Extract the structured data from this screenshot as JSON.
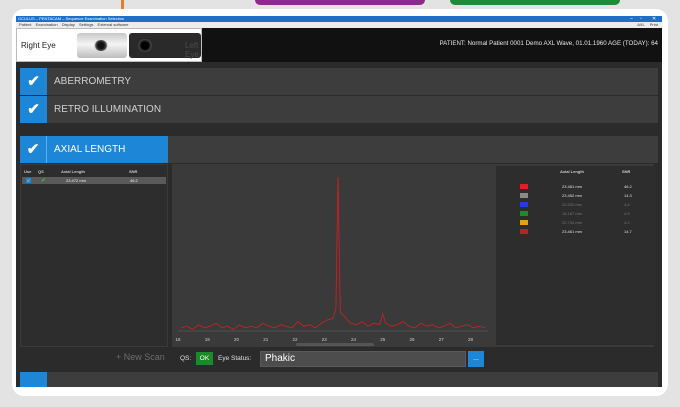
{
  "window": {
    "title": "OCULUS – PENTACAM – Sequence Examination Selection",
    "controls": [
      "–",
      "▫",
      "✕"
    ]
  },
  "menu": {
    "items": [
      "Patient",
      "Examination",
      "Display",
      "Settings",
      "External software"
    ],
    "right_items": [
      "AXL",
      "Print"
    ]
  },
  "header": {
    "right_eye_label": "Right Eye",
    "left_eye_label": "Left Eye",
    "patient_info": "PATIENT: Normal Patient 0001 Demo AXL Wave, 01.01.1960   AGE (TODAY): 64"
  },
  "sections": [
    {
      "label": "ABERROMETRY",
      "checked": true
    },
    {
      "label": "RETRO ILLUMINATION",
      "checked": true
    },
    {
      "label": "AXIAL LENGTH",
      "checked": true,
      "active": true
    }
  ],
  "scan_table": {
    "headers": [
      "Use",
      "QS",
      "Axial Length",
      "SNR"
    ],
    "rows": [
      {
        "axial_length": "23.472 mm",
        "snr": "46.2"
      }
    ]
  },
  "legend": {
    "headers": [
      "Axial Length",
      "SNR"
    ],
    "rows": [
      {
        "color": "#e02020",
        "axial_length": "23.481 mm",
        "snr": "46.2"
      },
      {
        "color": "#8a8a8a",
        "axial_length": "23.452 mm",
        "snr": "14.3"
      },
      {
        "color": "#1f3fd8",
        "axial_length": "20.330 mm",
        "snr": "4.6"
      },
      {
        "color": "#1f8a2a",
        "axial_length": "18.187 mm",
        "snr": "4.9"
      },
      {
        "color": "#e0a020",
        "axial_length": "22.734 mm",
        "snr": "4.2"
      },
      {
        "color": "#c02020",
        "axial_length": "23.461 mm",
        "snr": "14.7"
      }
    ]
  },
  "chart_data": {
    "type": "line",
    "x_ticks": [
      "18",
      "19",
      "20",
      "21",
      "22",
      "23",
      "24",
      "25",
      "26",
      "27",
      "28"
    ],
    "xlim": [
      18,
      28.6
    ],
    "ylim": [
      0,
      100
    ],
    "series": [
      {
        "color": "#d42020",
        "x": [
          18.1,
          18.3,
          18.5,
          18.7,
          18.9,
          19.1,
          19.3,
          19.5,
          19.7,
          19.9,
          20.1,
          20.3,
          20.5,
          20.7,
          20.9,
          21.1,
          21.3,
          21.5,
          21.7,
          21.9,
          22.1,
          22.3,
          22.5,
          22.7,
          22.9,
          23.1,
          23.3,
          23.4,
          23.47,
          23.55,
          23.7,
          23.9,
          24.1,
          24.3,
          24.5,
          24.7,
          24.9,
          25.0,
          25.1,
          25.3,
          25.5,
          25.7,
          25.9,
          26.1,
          26.3,
          26.5,
          26.7,
          26.9,
          27.1,
          27.3,
          27.5,
          27.7,
          27.9,
          28.1,
          28.3,
          28.5
        ],
        "y": [
          2,
          3,
          1,
          4,
          2,
          3,
          5,
          2,
          3,
          1,
          4,
          2,
          3,
          2,
          5,
          3,
          2,
          4,
          3,
          2,
          6,
          3,
          4,
          2,
          5,
          7,
          8,
          14,
          98,
          12,
          9,
          5,
          4,
          6,
          3,
          5,
          4,
          11,
          5,
          3,
          4,
          6,
          3,
          2,
          5,
          3,
          4,
          2,
          3,
          5,
          2,
          3,
          4,
          2,
          3,
          2
        ]
      }
    ]
  },
  "bottom": {
    "new_scan_label": "+ New Scan",
    "qs_label": "QS:",
    "qs_status": "OK",
    "eye_status_label": "Eye Status:",
    "eye_status_value": "Phakic",
    "more_button": "..."
  }
}
